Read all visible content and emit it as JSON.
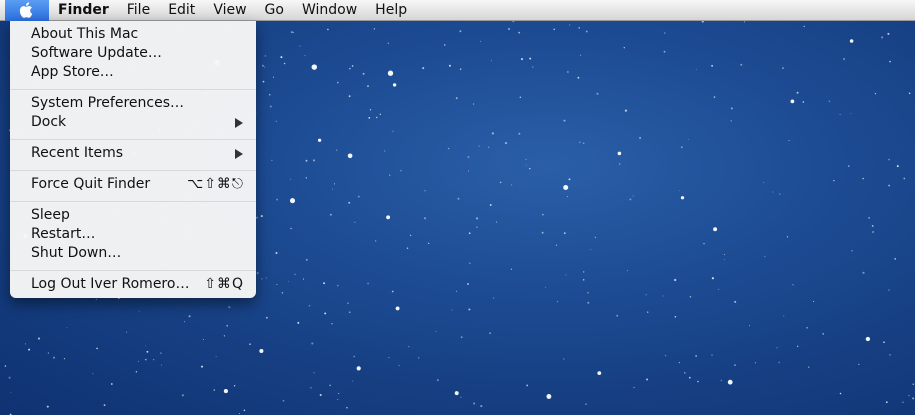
{
  "menubar": {
    "apple_icon": "apple-logo-icon",
    "items": [
      "Finder",
      "File",
      "Edit",
      "View",
      "Go",
      "Window",
      "Help"
    ]
  },
  "apple_menu": {
    "groups": [
      [
        {
          "label": "About This Mac"
        },
        {
          "label": "Software Update…"
        },
        {
          "label": "App Store…"
        }
      ],
      [
        {
          "label": "System Preferences…"
        },
        {
          "label": "Dock",
          "submenu": true
        }
      ],
      [
        {
          "label": "Recent Items",
          "submenu": true
        }
      ],
      [
        {
          "label": "Force Quit Finder",
          "shortcut": "⌥⇧⌘⎋"
        }
      ],
      [
        {
          "label": "Sleep"
        },
        {
          "label": "Restart…"
        },
        {
          "label": "Shut Down…"
        }
      ],
      [
        {
          "label": "Log Out Iver Romero…",
          "shortcut": "⇧⌘Q"
        }
      ]
    ]
  },
  "colors": {
    "desktop": "#1d4c94",
    "apple_highlight": "#2a6fe0",
    "menu_bg": "#f6f6f6"
  }
}
